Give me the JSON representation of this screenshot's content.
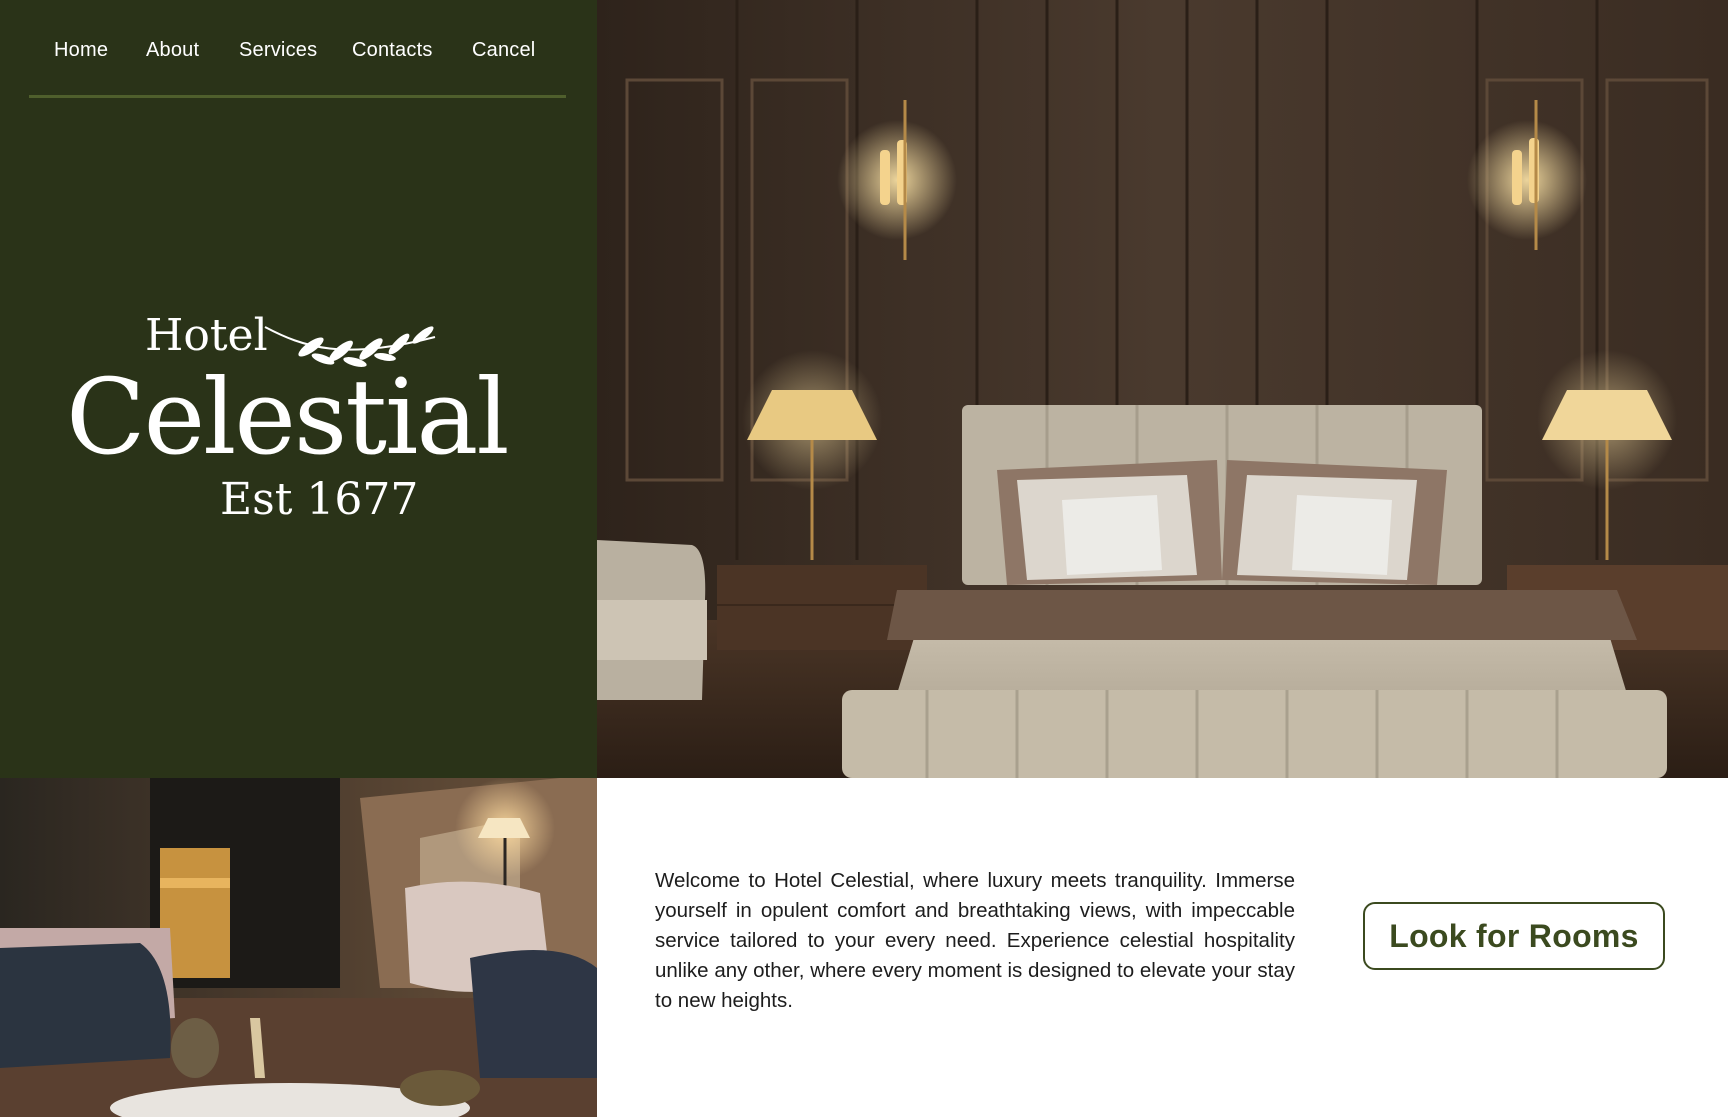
{
  "nav": {
    "items": [
      {
        "label": "Home"
      },
      {
        "label": "About"
      },
      {
        "label": "Services"
      },
      {
        "label": "Contacts"
      },
      {
        "label": "Cancel"
      }
    ]
  },
  "logo": {
    "line1": "Hotel",
    "line2": "Celestial",
    "line3": "Est 1677"
  },
  "hero": {
    "welcome_text": "Welcome to Hotel Celestial, where luxury meets tranquility. Immerse yourself in opulent comfort and breathtaking views, with impeccable service tailored to your every need. Experience celestial hospitality unlike any other, where every moment is designed to elevate your stay to new heights.",
    "cta_label": "Look for Rooms"
  },
  "colors": {
    "panel_green": "#2a3318",
    "divider_green": "#4f5f2c",
    "button_green": "#3b4a1f",
    "text_dark": "#1d1d1d"
  },
  "images": {
    "bedroom": "luxury-bedroom-photo",
    "lounge": "hotel-lounge-photo"
  }
}
